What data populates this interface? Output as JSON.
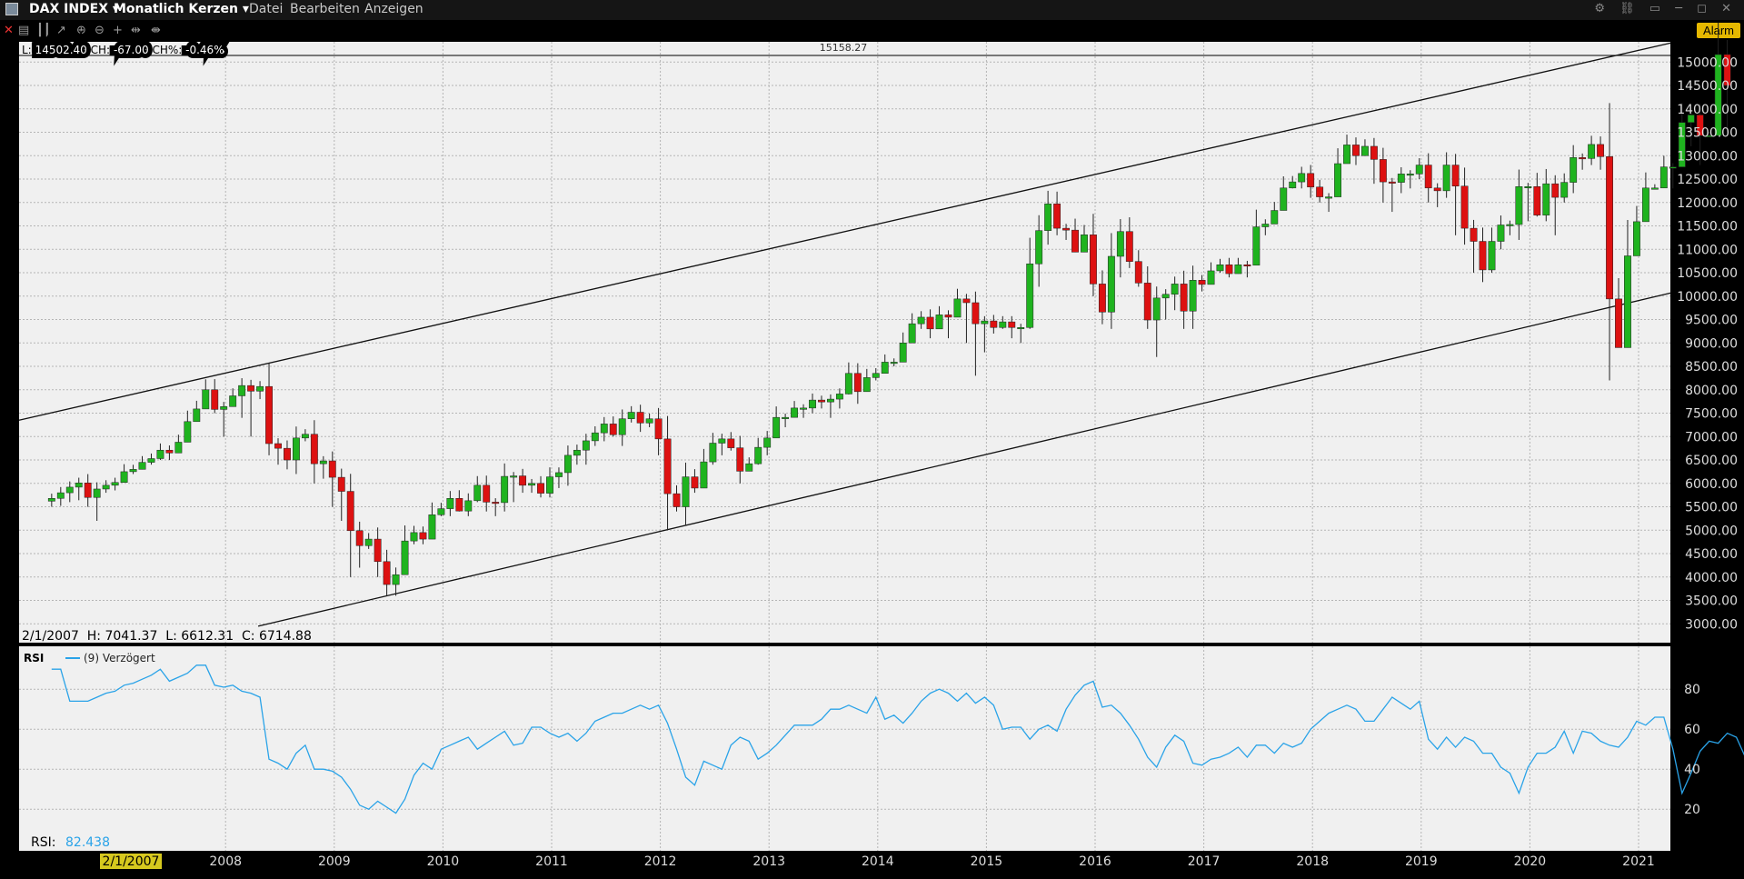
{
  "titlebar": {
    "symbol": "DAX INDEX",
    "period": "Monatlich Kerzen",
    "menu": [
      "Datei",
      "Bearbeiten",
      "Anzeigen"
    ]
  },
  "toolbar": {
    "alarm_label": "Alarm"
  },
  "info": {
    "top_label": "15158.27",
    "l_prefix": "L:",
    "l_value": "14502.40",
    "ch_prefix": "CH:",
    "ch_value": "-67.00",
    "chp_prefix": "CH%:",
    "chp_value": "-0.46%",
    "bottom_text": "2/1/2007  H: 7041.37  L: 6612.31  C: 6714.88"
  },
  "rsi_panel": {
    "title": "RSI",
    "legend": "(9) Verzögert",
    "value_label": "RSI:",
    "value": "82.438"
  },
  "crosshair_date": "2/1/2007",
  "colors": {
    "up": "#1fb31f",
    "down": "#dd1111",
    "rsi": "#2aa3e8",
    "background": "#f0f0f0",
    "grid": "#b5b5b5"
  },
  "chart_data": [
    {
      "type": "candlestick",
      "title": "DAX INDEX Monatlich Kerzen",
      "x_ticks": [
        "2008",
        "2009",
        "2010",
        "2011",
        "2012",
        "2013",
        "2014",
        "2015",
        "2016",
        "2017",
        "2018",
        "2019",
        "2020",
        "2021"
      ],
      "y_ticks": [
        3000,
        3500,
        4000,
        4500,
        5000,
        5500,
        6000,
        6500,
        7000,
        7500,
        8000,
        8500,
        9000,
        9500,
        10000,
        10500,
        11000,
        11500,
        12000,
        12500,
        13000,
        13500,
        14000,
        14500,
        15000
      ],
      "ylim": [
        2800,
        15300
      ],
      "x_start": 2006.4,
      "x_step": 0.08333,
      "closes": [
        5680,
        5800,
        5920,
        6010,
        5700,
        5880,
        5960,
        6020,
        6250,
        6300,
        6450,
        6530,
        6710,
        6650,
        6880,
        7320,
        7590,
        8000,
        7580,
        7640,
        7870,
        8090,
        7970,
        8070,
        6850,
        6750,
        6500,
        6970,
        7050,
        6420,
        6480,
        6130,
        5830,
        4990,
        4670,
        4810,
        4330,
        3840,
        4050,
        4770,
        4950,
        4810,
        5330,
        5460,
        5680,
        5410,
        5630,
        5960,
        5600,
        5590,
        6150,
        6160,
        5960,
        6000,
        5790,
        6140,
        6230,
        6600,
        6710,
        6910,
        7080,
        7270,
        7040,
        7380,
        7520,
        7290,
        7380,
        6950,
        5780,
        5500,
        6140,
        5900,
        6460,
        6860,
        6950,
        6760,
        6260,
        6420,
        6770,
        6970,
        7410,
        7410,
        7610,
        7610,
        7780,
        7740,
        7800,
        7910,
        8350,
        7960,
        8260,
        8350,
        8590,
        8590,
        9000,
        9410,
        9550,
        9300,
        9600,
        9550,
        9940,
        9860,
        9410,
        9470,
        9330,
        9450,
        9330,
        9330,
        10690,
        11400,
        11970,
        11450,
        11410,
        10940,
        11310,
        10260,
        9660,
        10850,
        11380,
        10740,
        10280,
        9490,
        9960,
        10040,
        10260,
        9680,
        10340,
        10250,
        10540,
        10670,
        10480,
        10670,
        10660,
        11480,
        11540,
        11830,
        12310,
        12440,
        12620,
        12330,
        12120,
        12120,
        12830,
        13230,
        13000,
        13200,
        12920,
        12440,
        12430,
        12610,
        12610,
        12800,
        12310,
        12250,
        12800,
        12350,
        11450,
        11170,
        10560,
        11170,
        11520,
        11530,
        12340,
        12340,
        11730,
        12400,
        12110,
        12430,
        12960,
        12940,
        13240,
        12980,
        9940,
        8900,
        10860,
        11590,
        12310,
        12310,
        12760,
        12760,
        13710,
        13870,
        13430,
        13430,
        15160,
        14500
      ],
      "lows": [
        5500,
        5520,
        5600,
        5640,
        5500,
        5200,
        5800,
        5850,
        6100,
        6200,
        6300,
        6400,
        6500,
        6500,
        6700,
        7200,
        7500,
        7800,
        7500,
        7000,
        7700,
        7400,
        7000,
        7800,
        6600,
        6400,
        6300,
        6200,
        6900,
        6000,
        6100,
        5500,
        5200,
        4000,
        4200,
        4600,
        4000,
        3600,
        3600,
        4200,
        4700,
        4700,
        4900,
        5300,
        5300,
        5400,
        5300,
        5600,
        5400,
        5300,
        5400,
        5600,
        5800,
        5800,
        5700,
        5700,
        5900,
        5950,
        6400,
        6400,
        6800,
        6900,
        7000,
        6800,
        7300,
        7100,
        7200,
        6600,
        5000,
        5400,
        5100,
        5800,
        6100,
        6400,
        6600,
        6700,
        6000,
        6300,
        6400,
        6600,
        7000,
        7200,
        7500,
        7400,
        7500,
        7600,
        7400,
        7600,
        7900,
        7700,
        8000,
        8200,
        8400,
        8500,
        8700,
        9000,
        9300,
        9100,
        9300,
        9100,
        9700,
        9000,
        8300,
        8800,
        9200,
        9300,
        9100,
        9000,
        9300,
        10200,
        11100,
        11300,
        11200,
        11100,
        11000,
        10000,
        9400,
        9300,
        10400,
        10600,
        10200,
        9300,
        8700,
        9500,
        9700,
        9300,
        9300,
        10100,
        10400,
        10500,
        10400,
        10500,
        10400,
        11000,
        11300,
        11800,
        12200,
        12300,
        12300,
        12100,
        12000,
        11800,
        12600,
        12900,
        12800,
        13200,
        12400,
        12000,
        11800,
        12200,
        12300,
        12500,
        12000,
        11900,
        12100,
        11300,
        11100,
        10500,
        10300,
        10500,
        11000,
        11300,
        11200,
        11600,
        11700,
        11600,
        11300,
        12000,
        12200,
        12700,
        12800,
        12700,
        8200,
        9300,
        10400,
        11300,
        11900,
        12300,
        12500,
        12300,
        12800,
        13200,
        12800,
        13400,
        13600,
        13500,
        15300,
        14100
      ]
    },
    {
      "type": "line",
      "title": "RSI",
      "series": [
        {
          "name": "(9) Verzögert"
        }
      ],
      "y_ticks": [
        20,
        40,
        60,
        80
      ],
      "ylim": [
        5,
        95
      ],
      "x_start": 2006.4,
      "x_step": 0.08333,
      "values": [
        90,
        90,
        74,
        74,
        74,
        76,
        78,
        79,
        82,
        83,
        85,
        87,
        90,
        84,
        86,
        88,
        92,
        92,
        82,
        81,
        82,
        79,
        78,
        76,
        45,
        43,
        40,
        48,
        52,
        40,
        40,
        39,
        36,
        30,
        22,
        20,
        24,
        21,
        18,
        25,
        37,
        43,
        40,
        50,
        52,
        54,
        56,
        50,
        53,
        56,
        59,
        52,
        53,
        61,
        61,
        58,
        56,
        58,
        54,
        58,
        64,
        66,
        68,
        68,
        70,
        72,
        70,
        72,
        63,
        50,
        36,
        32,
        44,
        42,
        40,
        52,
        56,
        54,
        45,
        48,
        52,
        57,
        62,
        62,
        62,
        65,
        70,
        70,
        72,
        70,
        68,
        76,
        65,
        67,
        63,
        68,
        74,
        78,
        80,
        78,
        74,
        78,
        73,
        76,
        72,
        60,
        61,
        61,
        55,
        60,
        62,
        59,
        70,
        77,
        82,
        84,
        71,
        72,
        68,
        62,
        55,
        46,
        41,
        51,
        57,
        54,
        43,
        42,
        45,
        46,
        48,
        51,
        46,
        52,
        52,
        48,
        53,
        51,
        53,
        60,
        64,
        68,
        70,
        72,
        70,
        64,
        64,
        70,
        76,
        73,
        70,
        74,
        55,
        50,
        56,
        51,
        56,
        54,
        48,
        48,
        41,
        38,
        28,
        41,
        48,
        48,
        51,
        59,
        48,
        59,
        58,
        54,
        52,
        51,
        56,
        64,
        62,
        66,
        66,
        50,
        28,
        38,
        49,
        54,
        53,
        58,
        56,
        46,
        60,
        62,
        60,
        61,
        65,
        82
      ]
    }
  ]
}
